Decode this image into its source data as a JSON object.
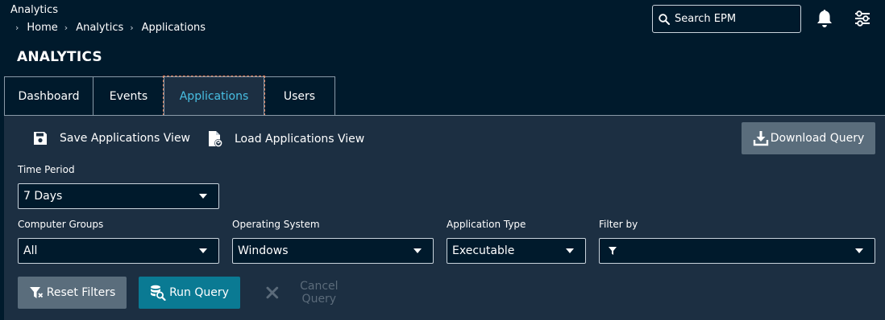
{
  "header": {
    "app_title": "Analytics",
    "breadcrumb": [
      "Home",
      "Analytics",
      "Applications"
    ],
    "page_title": "ANALYTICS",
    "search": {
      "placeholder": "Search EPM"
    }
  },
  "tabs": [
    {
      "label": "Dashboard",
      "active": false
    },
    {
      "label": "Events",
      "active": false
    },
    {
      "label": "Applications",
      "active": true
    },
    {
      "label": "Users",
      "active": false
    }
  ],
  "toolbar": {
    "save_view_label": "Save Applications View",
    "load_view_label": "Load Applications View",
    "download_label": "Download Query"
  },
  "filters": {
    "time_period": {
      "label": "Time Period",
      "value": "7 Days"
    },
    "computer_groups": {
      "label": "Computer Groups",
      "value": "All"
    },
    "operating_system": {
      "label": "Operating System",
      "value": "Windows"
    },
    "application_type": {
      "label": "Application Type",
      "value": "Executable"
    },
    "filter_by": {
      "label": "Filter by",
      "value": ""
    }
  },
  "actions": {
    "reset_label": "Reset Filters",
    "run_label": "Run Query",
    "cancel_label": "Cancel Query"
  },
  "colors": {
    "background": "#001a2c",
    "panel": "#1c2f42",
    "accent": "#48bfe3",
    "run_button": "#0a7a93",
    "secondary_button": "#5a6d7c",
    "disabled_text": "#5b6b7a"
  },
  "icons": [
    "search-icon",
    "bell-icon",
    "settings-sliders-icon",
    "save-icon",
    "load-file-icon",
    "download-icon",
    "funnel-icon",
    "reset-filter-icon",
    "database-search-icon",
    "x-icon",
    "chevron-right-icon"
  ]
}
